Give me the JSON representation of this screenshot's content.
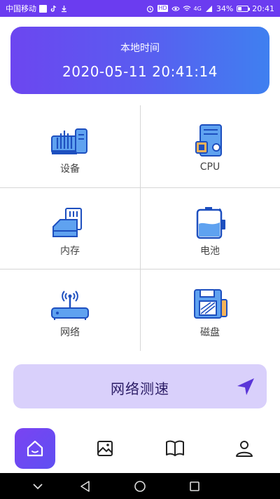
{
  "status_bar": {
    "carrier": "中国移动",
    "battery": "34%",
    "time": "20:41",
    "hd_badge": "HD",
    "network": "4G"
  },
  "time_card": {
    "title": "本地时间",
    "value": "2020-05-11 20:41:14"
  },
  "grid": [
    {
      "label": "设备",
      "icon": "device-icon"
    },
    {
      "label": "CPU",
      "icon": "cpu-icon"
    },
    {
      "label": "内存",
      "icon": "memory-icon"
    },
    {
      "label": "电池",
      "icon": "battery-icon"
    },
    {
      "label": "网络",
      "icon": "router-icon"
    },
    {
      "label": "磁盘",
      "icon": "disk-icon"
    }
  ],
  "speed_test": {
    "label": "网络测速",
    "icon": "send-arrow-icon"
  },
  "bottom_nav": [
    {
      "icon": "home-icon",
      "active": true
    },
    {
      "icon": "image-icon",
      "active": false
    },
    {
      "icon": "book-icon",
      "active": false
    },
    {
      "icon": "user-icon",
      "active": false
    }
  ],
  "colors": {
    "accent": "#6b3cf0",
    "card_gradient_start": "#6c46f0",
    "card_gradient_end": "#3f80f0",
    "icon_blue": "#2f6de0",
    "speed_bg": "#d9d0fb"
  }
}
